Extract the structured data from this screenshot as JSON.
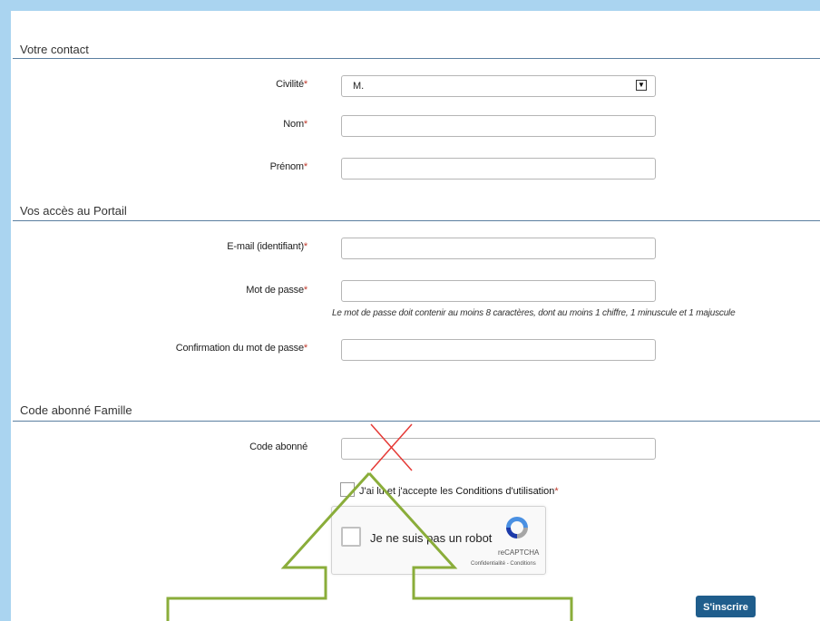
{
  "sections": {
    "contact": "Votre contact",
    "access": "Vos accès au Portail",
    "subscriber": "Code abonné Famille"
  },
  "fields": {
    "civilite": {
      "label": "Civilité",
      "value": "M."
    },
    "nom": {
      "label": "Nom",
      "value": ""
    },
    "prenom": {
      "label": "Prénom",
      "value": ""
    },
    "email": {
      "label": "E-mail (identifiant)",
      "value": ""
    },
    "password": {
      "label": "Mot de passe",
      "value": ""
    },
    "password_hint": "Le mot de passe doit contenir au moins 8 caractères, dont au moins 1 chiffre, 1 minuscule et 1 majuscule",
    "password_confirm": {
      "label": "Confirmation du mot de passe",
      "value": ""
    },
    "code": {
      "label": "Code abonné",
      "value": ""
    }
  },
  "required_marker": "*",
  "terms": {
    "prefix": "J'ai lu et j'accepte les ",
    "link": "Conditions d'utilisation",
    "checked": false
  },
  "captcha": {
    "label": "Je ne suis pas un robot",
    "brand": "reCAPTCHA",
    "links": "Confidentialité - Conditions"
  },
  "submit_label": "S'inscrire",
  "colors": {
    "frame": "#aad4f0",
    "section_line": "#5b7fa0",
    "required": "#c0392b",
    "submit_bg": "#1f5d8c",
    "annotation_arrow": "#8aad3a",
    "annotation_cross": "#e53935"
  },
  "icons": {
    "dropdown": "chevron-down-icon",
    "captcha_logo": "recaptcha-icon",
    "cross": "cross-mark-icon",
    "arrow": "up-arrow-icon"
  }
}
